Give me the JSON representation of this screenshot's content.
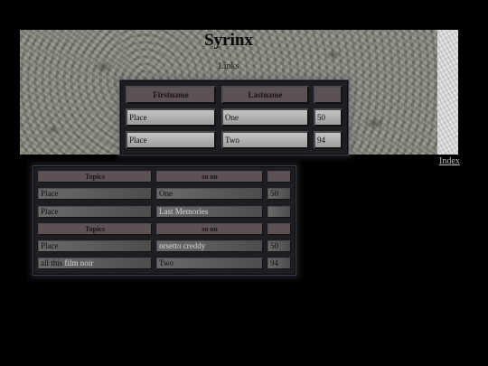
{
  "header": {
    "title": "Syrinx",
    "links_label": "Links",
    "index_label": "Index"
  },
  "table_top": {
    "headers": [
      "Firstname",
      "Lastname",
      ""
    ],
    "rows": [
      [
        "Place",
        "One",
        "50"
      ],
      [
        "Place",
        "Two",
        "94"
      ]
    ]
  },
  "table_bottom": {
    "headers": [
      "Topics",
      "so on",
      ""
    ],
    "rows": [
      {
        "a": "Place",
        "a_extra": "",
        "b": "One",
        "c": "50"
      },
      {
        "a": "Place",
        "a_extra": "",
        "b": "Last Memories",
        "c": ""
      },
      {
        "a": "Place",
        "a_extra": "",
        "b": "orsetto creddy",
        "c": "50"
      },
      {
        "a": "all this ",
        "a_extra": "film noir",
        "b": "Two",
        "c": "94"
      }
    ],
    "headers_repeat": [
      "Topics",
      "so on",
      ""
    ]
  }
}
